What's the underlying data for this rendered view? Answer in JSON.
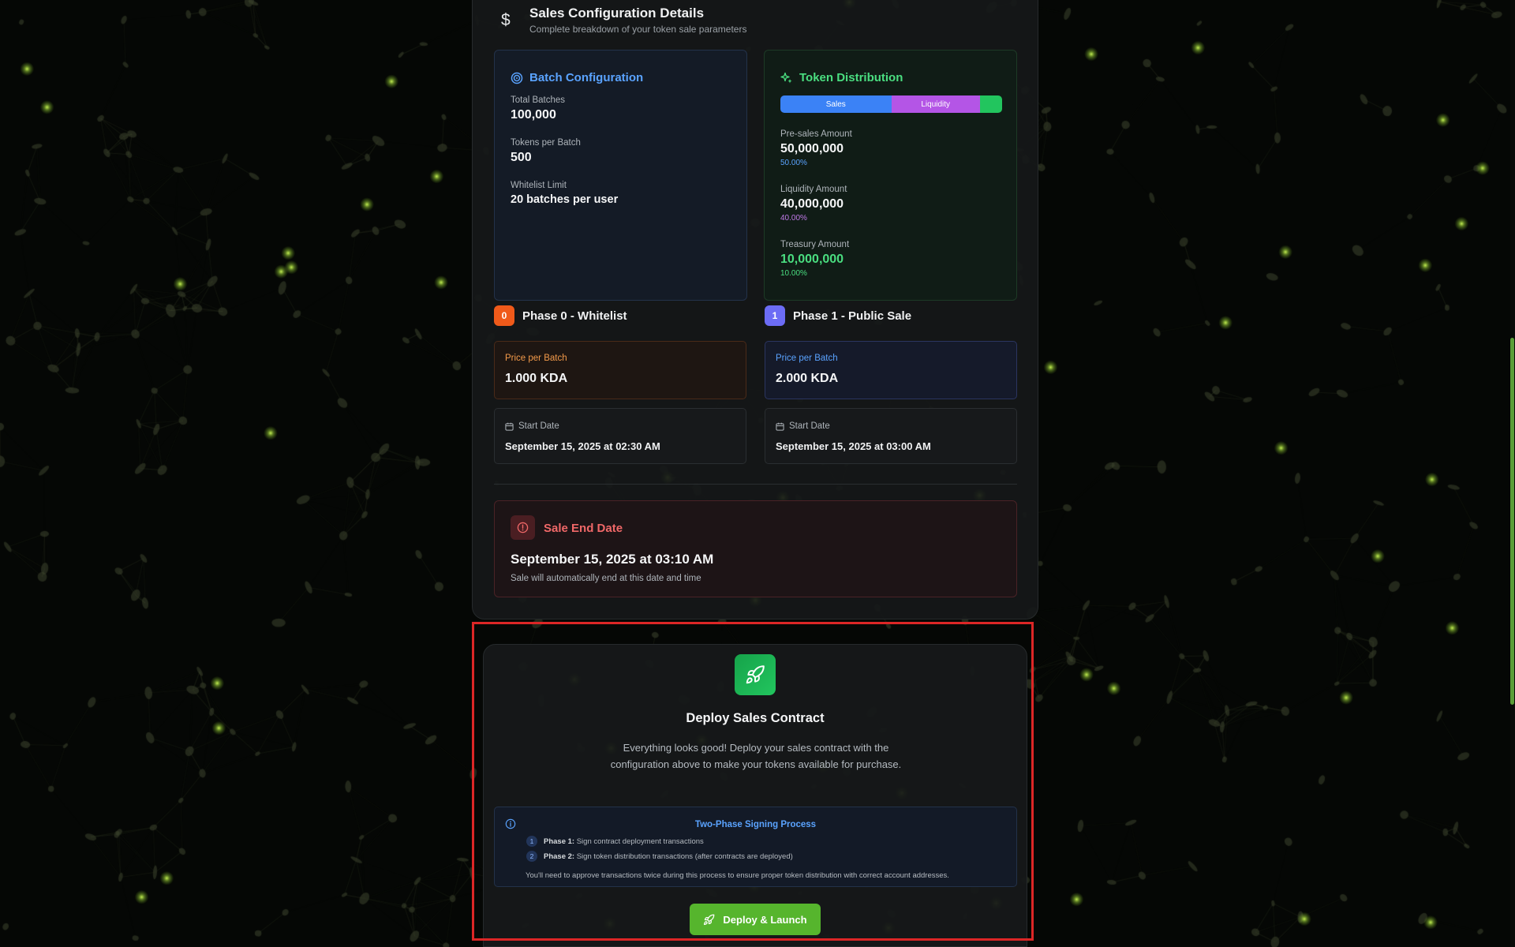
{
  "config": {
    "title": "Sales Configuration Details",
    "subtitle": "Complete breakdown of your token sale parameters",
    "currency_symbol": "$"
  },
  "batch": {
    "title": "Batch Configuration",
    "total_label": "Total Batches",
    "total_value": "100,000",
    "per_batch_label": "Tokens per Batch",
    "per_batch_value": "500",
    "whitelist_label": "Whitelist Limit",
    "whitelist_value": "20 batches per user"
  },
  "distribution": {
    "title": "Token Distribution",
    "bar": [
      {
        "label": "Sales",
        "percent": 50,
        "color": "#3b82f6"
      },
      {
        "label": "Liquidity",
        "percent": 40,
        "color": "#b455e6"
      },
      {
        "label": "",
        "percent": 10,
        "color": "#22c55e"
      }
    ],
    "presales_label": "Pre-sales Amount",
    "presales_value": "50,000,000",
    "presales_pct": "50.00%",
    "liquidity_label": "Liquidity Amount",
    "liquidity_value": "40,000,000",
    "liquidity_pct": "40.00%",
    "treasury_label": "Treasury Amount",
    "treasury_value": "10,000,000",
    "treasury_pct": "10.00%"
  },
  "phase0": {
    "number": "0",
    "title": "Phase 0 - Whitelist",
    "price_label": "Price per Batch",
    "price_value": "1.000 KDA",
    "start_label": "Start Date",
    "start_value": "September 15, 2025 at 02:30 AM"
  },
  "phase1": {
    "number": "1",
    "title": "Phase 1 - Public Sale",
    "price_label": "Price per Batch",
    "price_value": "2.000 KDA",
    "start_label": "Start Date",
    "start_value": "September 15, 2025 at 03:00 AM"
  },
  "end": {
    "title": "Sale End Date",
    "value": "September 15, 2025 at 03:10 AM",
    "subtitle": "Sale will automatically end at this date and time"
  },
  "deploy": {
    "title": "Deploy Sales Contract",
    "description": "Everything looks good! Deploy your sales contract with the configuration above to make your tokens available for purchase.",
    "signing": {
      "title": "Two-Phase Signing Process",
      "steps": [
        {
          "num": "1",
          "label": "Phase 1:",
          "text": "Sign contract deployment transactions"
        },
        {
          "num": "2",
          "label": "Phase 2:",
          "text": "Sign token distribution transactions (after contracts are deployed)"
        }
      ],
      "note": "You'll need to approve transactions twice during this process to ensure proper token distribution with correct account addresses."
    },
    "button_label": "Deploy & Launch"
  },
  "colors": {
    "accent_green": "#56b52d",
    "highlight_red": "#dc2626",
    "blue": "#5aa3ff",
    "orange": "#f05a1a"
  }
}
